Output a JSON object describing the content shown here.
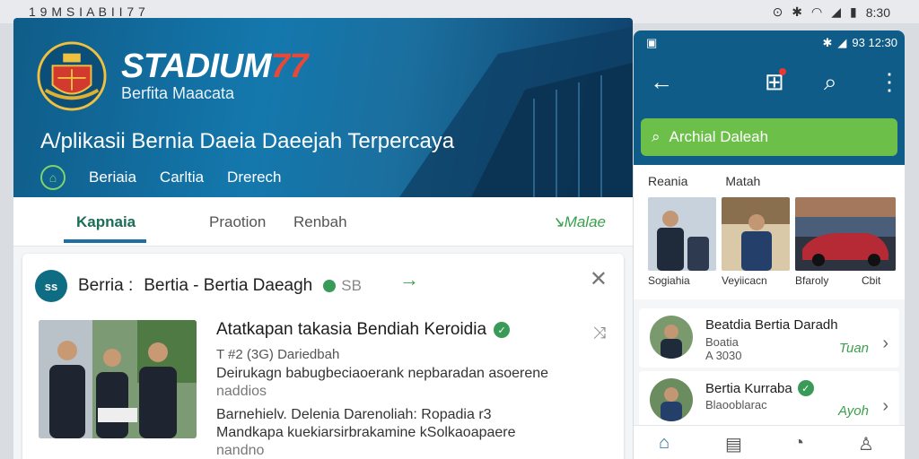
{
  "outer_status": {
    "left_text": "1 9 M  S I A B I I  7 7",
    "right_time": "8:30"
  },
  "brand": {
    "name_main": "STADIUM",
    "name_accent": "77",
    "subtitle": "Berfita Maacata"
  },
  "hero": {
    "tagline": "A/plikasii Bernia Daeia Daeejah Terpercaya",
    "nav": [
      "Beriaia",
      "Carltia",
      "Drerech"
    ]
  },
  "tabs": {
    "items": [
      "Kapnaia",
      "Praotion",
      "Renbah"
    ],
    "more": "Malae"
  },
  "card": {
    "logo_text": "ss",
    "source": "Berria :",
    "source_detail": "Bertia - Bertia Daeagh",
    "sb": "SB",
    "title": "Atatkapan takasia Bendiah Keroidia",
    "meta": "T #2 (3G) Dariedbah",
    "body_lines": [
      "Deirukagn babugbeciaoerank nepbaradan asoerene",
      "naddios",
      "Barnehielv. Delenia Darenoliah: Ropadia r3",
      "Mandkapa kuekiarsirbrakamine kSolkaoapaere",
      "nandno"
    ]
  },
  "phone": {
    "status": {
      "left": "▣",
      "right": "93  12:30"
    },
    "search": "Archial Daleah",
    "section_labels": [
      "Reania",
      "Matah"
    ],
    "thumb_captions": [
      "Sogiahia",
      "Veyiicacn",
      "Bfaroly",
      "Cbit"
    ],
    "list": [
      {
        "title": "Beatdia Bertia Daradh",
        "sub1": "Boatia",
        "sub2": "A 3030",
        "right": "Tuan"
      },
      {
        "title": "Bertia Kurraba",
        "sub1": "Blaooblarac",
        "sub2": "",
        "right": "Ayoh"
      }
    ]
  },
  "colors": {
    "primary": "#0f5c88",
    "accent_green": "#6cc04a",
    "brand_red": "#e4493a"
  }
}
